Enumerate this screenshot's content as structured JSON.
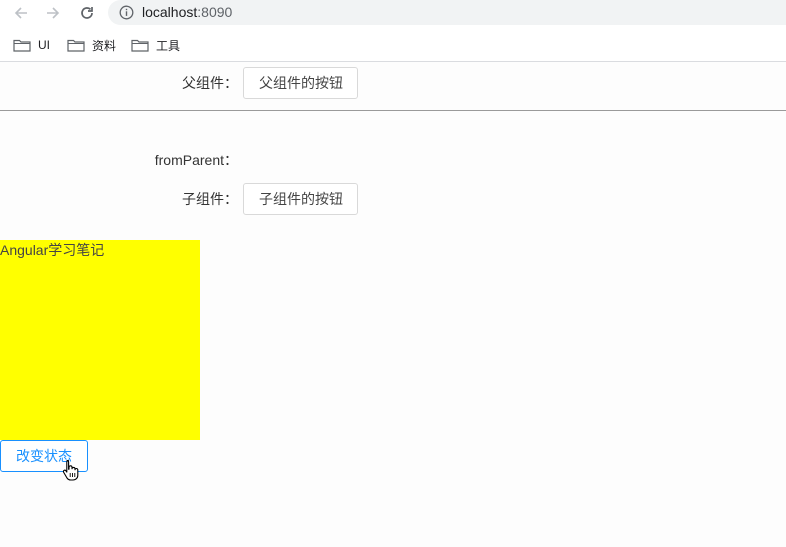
{
  "browser": {
    "url_host": "localhost",
    "url_port": ":8090",
    "bookmarks": [
      {
        "label": "UI",
        "icon": "folder-icon"
      },
      {
        "label": "资料",
        "icon": "folder-icon"
      },
      {
        "label": "工具",
        "icon": "folder-icon"
      }
    ]
  },
  "parent": {
    "label": "父组件：",
    "button_label": "父组件的按钮"
  },
  "child": {
    "from_parent_label": "fromParent：",
    "from_parent_value": "",
    "label": "子组件：",
    "button_label": "子组件的按钮"
  },
  "animated_box": {
    "text": "Angular学习笔记",
    "color": "#ffff00"
  },
  "toggle": {
    "button_label": "改变状态",
    "accent_color": "#1890ff"
  }
}
